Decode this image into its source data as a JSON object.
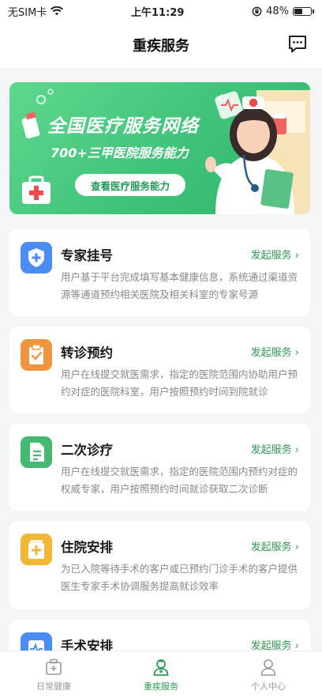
{
  "status_bar": {
    "carrier": "无SIM卡",
    "time": "上午11:29",
    "battery": "48%"
  },
  "nav": {
    "title": "重疾服务",
    "message_icon": "message-icon"
  },
  "banner": {
    "title": "全国医疗服务网络",
    "subtitle": "700+三甲医院服务能力",
    "button": "查看医疗服务能力"
  },
  "services": [
    {
      "title": "专家挂号",
      "action": "发起服务 ›",
      "desc": "用户基于平台完成填写基本健康信息，系统通过渠道资源等通道预约相关医院及相关科室的专家号源",
      "icon": "shield-plus-icon",
      "color": "#4a8cf0"
    },
    {
      "title": "转诊预约",
      "action": "发起服务 ›",
      "desc": "用户在线提交就医需求，指定的医院范围内协助用户预约对症的医院科室，用户按照预约时间到院就诊",
      "icon": "clipboard-check-icon",
      "color": "#f0953f"
    },
    {
      "title": "二次诊疗",
      "action": "发起服务 ›",
      "desc": "用户在线提交就医需求，指定的医院范围内预约对症的权威专家，用户按照预约时间就诊获取二次诊断",
      "icon": "document-icon",
      "color": "#45b873"
    },
    {
      "title": "住院安排",
      "action": "发起服务 ›",
      "desc": "为已入院等待手术的客户或已预约门诊手术的客户提供医生专家手术协调服务提高就诊效率",
      "icon": "hospital-bed-icon",
      "color": "#f2b637"
    },
    {
      "title": "手术安排",
      "action": "发起服务 ›",
      "desc": "",
      "icon": "heartbeat-icon",
      "color": "#4a8cf0"
    }
  ],
  "tabs": [
    {
      "label": "日常健康",
      "icon": "medical-kit-icon"
    },
    {
      "label": "重疾服务",
      "icon": "doctor-icon",
      "active": true
    },
    {
      "label": "个人中心",
      "icon": "person-icon"
    }
  ]
}
